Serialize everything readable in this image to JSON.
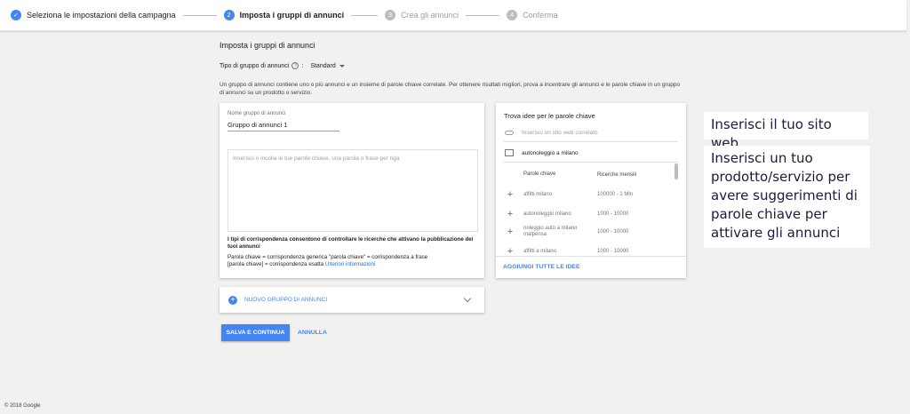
{
  "stepper": {
    "steps": [
      {
        "label": "Seleziona le impostazioni della campagna",
        "state": "done"
      },
      {
        "label": "Imposta i gruppi di annunci",
        "number": "2",
        "state": "active"
      },
      {
        "label": "Crea gli annunci",
        "number": "3",
        "state": "todo"
      },
      {
        "label": "Conferma",
        "number": "4",
        "state": "todo"
      }
    ]
  },
  "header": {
    "title": "Imposta i gruppi di annunci",
    "type_label": "Tipo di gruppo di annunci",
    "type_value": "Standard",
    "description": "Un gruppo di annunci contiene uno o più annunci e un insieme di parole chiave correlate. Per ottenere risultati migliori, prova a incentrare gli annunci e le parole chiave in un gruppo di annunci su un prodotto o servizio."
  },
  "ad_group": {
    "name_label": "Nome gruppo di annunci",
    "name_value": "Gruppo di annunci 1",
    "keywords_placeholder": "Inserisci o incolla le tue parole chiave, una parola o frase per riga",
    "match_title": "I tipi di corrispondenza consentono di controllare le ricerche che attivano la pubblicazione dei tuoi annunci",
    "match_line1": "Parola chiave = corrispondenza generica   \"parola chiave\" = corrispondenza a frase",
    "match_line2": "[parola chiave] = corrispondenza esatta",
    "more_info": "Ulteriori informazioni"
  },
  "new_group": {
    "label": "NUOVO GRUPPO DI ANNUNCI"
  },
  "actions": {
    "save": "SALVA E CONTINUA",
    "cancel": "ANNULLA"
  },
  "keyword_ideas": {
    "title": "Trova idee per le parole chiave",
    "website_placeholder": "Inserisci un sito web correlato",
    "product_value": "autonoleggio a milano",
    "col_keyword": "Parole chiave",
    "col_volume": "Ricerche mensili",
    "rows": [
      {
        "keyword": "affitti milano",
        "volume": "100000 - 1 Mln"
      },
      {
        "keyword": "autonoleggio milano",
        "volume": "1000 - 10000"
      },
      {
        "keyword": "noleggio auto a milano malpensa",
        "volume": "1000 - 10000"
      },
      {
        "keyword": "affitti a milano",
        "volume": "1000 - 10000"
      }
    ],
    "add_all": "AGGIUNGI TUTTE LE IDEE"
  },
  "annotations": {
    "website": "Inserisci il tuo sito web",
    "product": "Inserisci un tuo prodotto/servizio per avere suggerimenti di parole chiave per attivare gli annunci"
  },
  "footer": {
    "copyright": "© 2018 Google"
  }
}
